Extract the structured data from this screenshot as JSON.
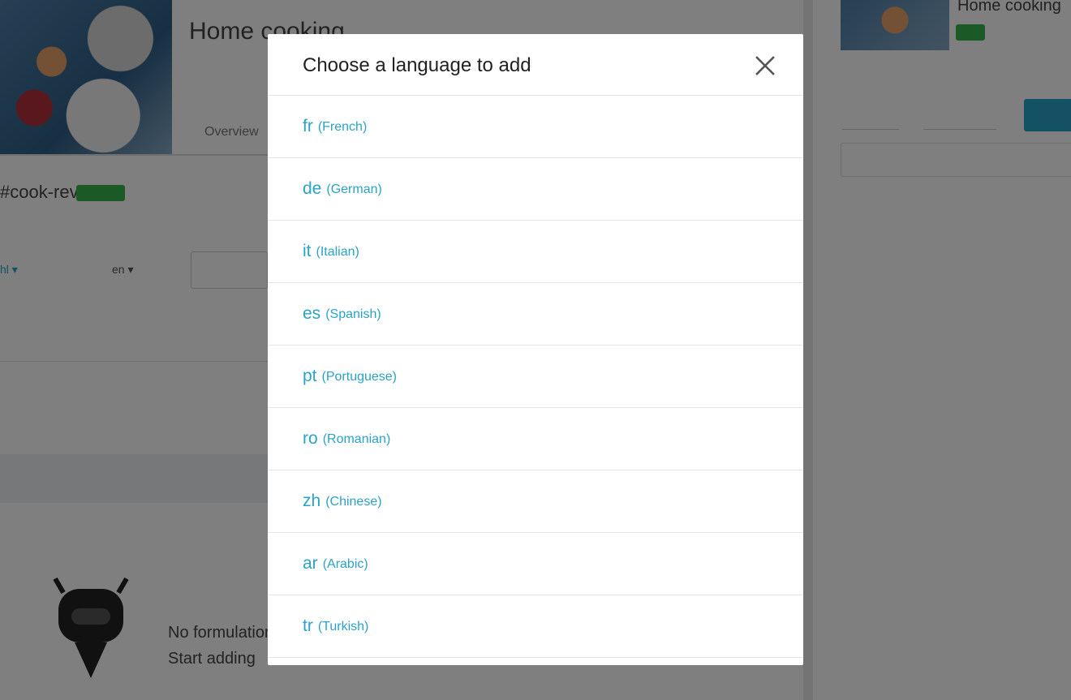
{
  "background": {
    "hero_title": "Home cooking",
    "hero_subtitle": "",
    "hero_tab": "Overview",
    "hash_text": "#cook-rev",
    "small_link": "hl ▾",
    "small_link_sub": "",
    "chip_label": "en ▾",
    "list_label": "",
    "empty_state_line1": "No formulations",
    "empty_state_line2": "Start adding"
  },
  "side_panel": {
    "title": "Home cooking",
    "meta": "",
    "labels": [
      "",
      "",
      ""
    ],
    "select_a": "",
    "select_b": "",
    "input_placeholder": ""
  },
  "modal": {
    "title": "Choose a language to add",
    "close_icon": "close-icon",
    "languages": [
      {
        "code": "fr",
        "name": "(French)"
      },
      {
        "code": "de",
        "name": "(German)"
      },
      {
        "code": "it",
        "name": "(Italian)"
      },
      {
        "code": "es",
        "name": "(Spanish)"
      },
      {
        "code": "pt",
        "name": "(Portuguese)"
      },
      {
        "code": "ro",
        "name": "(Romanian)"
      },
      {
        "code": "zh",
        "name": "(Chinese)"
      },
      {
        "code": "ar",
        "name": "(Arabic)"
      },
      {
        "code": "tr",
        "name": "(Turkish)"
      }
    ]
  },
  "colors": {
    "accent": "#2aa3c8",
    "badge_green": "#37b24d",
    "overlay": "rgba(0,0,0,0.5)"
  }
}
